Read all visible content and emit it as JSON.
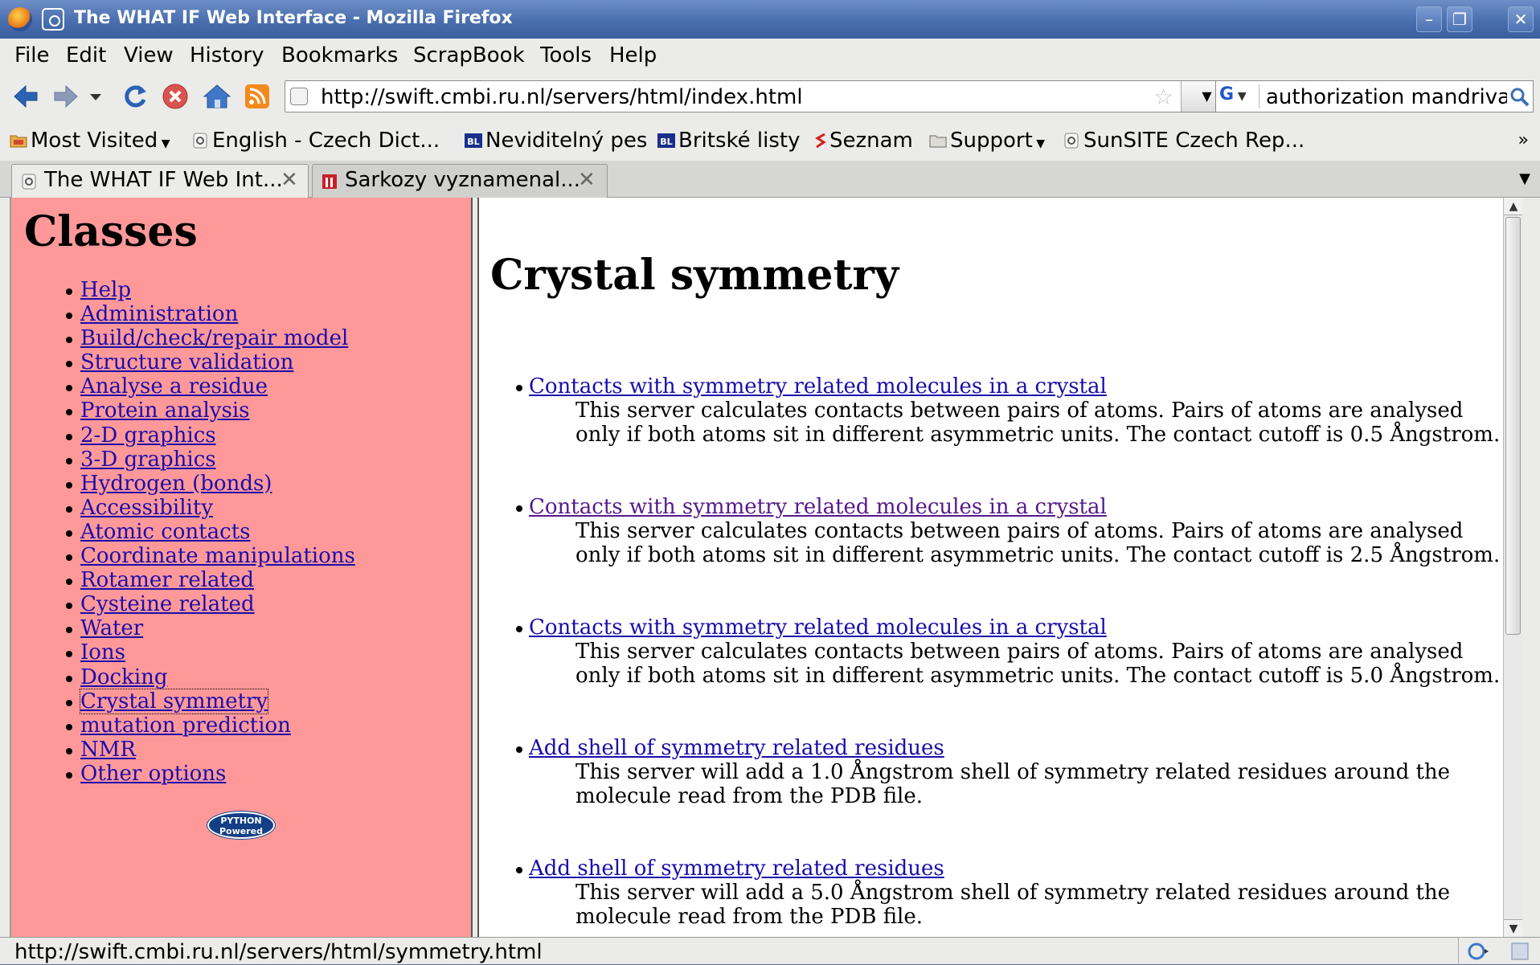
{
  "window": {
    "title": "The WHAT IF Web Interface - Mozilla Firefox",
    "minimize_glyph": "–",
    "restore_glyph": "❐",
    "close_glyph": "✕"
  },
  "menubar": {
    "items": [
      "File",
      "Edit",
      "View",
      "History",
      "Bookmarks",
      "ScrapBook",
      "Tools",
      "Help"
    ]
  },
  "navbar": {
    "url": "http://swift.cmbi.ru.nl/servers/html/index.html",
    "search_value": "authorization mandriva",
    "search_engine": "G"
  },
  "bookmarks": {
    "items": [
      "Most Visited",
      "English - Czech Dict...",
      "Neviditelný pes",
      "Britské listy",
      "Seznam",
      "Support",
      "SunSITE Czech Rep..."
    ],
    "overflow": "»"
  },
  "tabs": [
    {
      "label": "The WHAT IF Web Int...",
      "active": true
    },
    {
      "label": "Sarkozy vyznamenal...",
      "active": false
    }
  ],
  "left_frame": {
    "title": "Classes",
    "classes": [
      "Help",
      "Administration",
      "Build/check/repair model",
      "Structure validation",
      "Analyse a residue",
      "Protein analysis",
      "2-D graphics",
      "3-D graphics",
      "Hydrogen (bonds)",
      "Accessibility",
      "Atomic contacts",
      "Coordinate manipulations",
      "Rotamer related",
      "Cysteine related",
      "Water",
      "Ions",
      "Docking",
      "Crystal symmetry",
      "mutation prediction",
      "NMR",
      "Other options"
    ],
    "badge": {
      "line1": "PYTHON",
      "line2": "Powered"
    }
  },
  "right_frame": {
    "title": "Crystal symmetry",
    "entries": [
      {
        "link": "Contacts with symmetry related molecules in a crystal",
        "desc": "This server calculates contacts between pairs of atoms. Pairs of atoms are analysed only if both atoms sit in different asymmetric units. The contact cutoff is 0.5 Ångstrom."
      },
      {
        "link": "Contacts with symmetry related molecules in a crystal",
        "desc": "This server calculates contacts between pairs of atoms. Pairs of atoms are analysed only if both atoms sit in different asymmetric units. The contact cutoff is 2.5 Ångstrom."
      },
      {
        "link": "Contacts with symmetry related molecules in a crystal",
        "desc": "This server calculates contacts between pairs of atoms. Pairs of atoms are analysed only if both atoms sit in different asymmetric units. The contact cutoff is 5.0 Ångstrom."
      },
      {
        "link": "Add shell of symmetry related residues",
        "desc": "This server will add a 1.0 Ångstrom shell of symmetry related residues around the molecule read from the PDB file."
      },
      {
        "link": "Add shell of symmetry related residues",
        "desc": "This server will add a 5.0 Ångstrom shell of symmetry related residues around the molecule read from the PDB file."
      }
    ]
  },
  "statusbar": {
    "text": "http://swift.cmbi.ru.nl/servers/html/symmetry.html"
  },
  "colors": {
    "left_frame_bg": "#ff9999",
    "link": "#1a0dab",
    "visited_link": "#551a8b",
    "titlebar": "#4a6fae"
  }
}
